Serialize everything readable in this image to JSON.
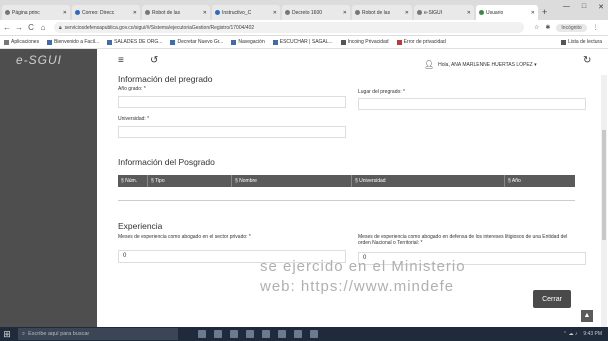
{
  "browser": {
    "tabs": [
      {
        "label": "Página princ"
      },
      {
        "label": "Correo: Direcc"
      },
      {
        "label": "Robot de las"
      },
      {
        "label": "Instructivo_C"
      },
      {
        "label": "Decreto 1600"
      },
      {
        "label": "Robot de las"
      },
      {
        "label": "e-SIGUI"
      },
      {
        "label": "Usuario",
        "active": true
      }
    ],
    "new_tab": "+",
    "url": "serviciosdefensapublica.gov.co/sigui/#/Sistema/ejecutoriaGestion/Registro/17004/402",
    "profile_label": "Incógnito",
    "window_controls": [
      "—",
      "□",
      "✕"
    ]
  },
  "bookmarks": {
    "items": [
      "Aplicaciones",
      "Bienvenido a Facil...",
      "SALADES DE ORG...",
      "Decretar Nuevo Gr...",
      "Navegación",
      "ESCUCHAR | SAGAL...",
      "Incoing Privacidad",
      "Error de privacidad"
    ],
    "reading_list": "Lista de lectura"
  },
  "app": {
    "logo": "e-SGUI",
    "user_label": "Hola, ANA MARLENNE HUERTAS LOPEZ ▾"
  },
  "pregrado": {
    "title": "Información del pregrado",
    "ano_grado_label": "Año grado: *",
    "lugar_label": "Lugar del pregrado: *",
    "universidad_label": "Universidad: *"
  },
  "posgrado": {
    "title": "Información del Posgrado",
    "columns": [
      "§ Núm.",
      "§ Tipo",
      "§ Nombre",
      "§ Universidad",
      "§ Año"
    ]
  },
  "experiencia": {
    "title": "Experiencia",
    "meses_label": "Meses de experiencia como abogado en el sector privado: *",
    "meses_value": "0",
    "defensa_label": "Meses de experiencia como abogado en defensa de los intereses litigiosos de una Entidad del orden Nacional o Territorial: *",
    "defensa_value": "0"
  },
  "watermark": {
    "line1": "se ejercido en el Ministerio",
    "line2": "web: https://www.mindefe"
  },
  "buttons": {
    "cerrar": "Cerrar"
  },
  "taskbar": {
    "search_placeholder": "Escribe aquí para buscar",
    "tray_time": "9:43 PM"
  }
}
